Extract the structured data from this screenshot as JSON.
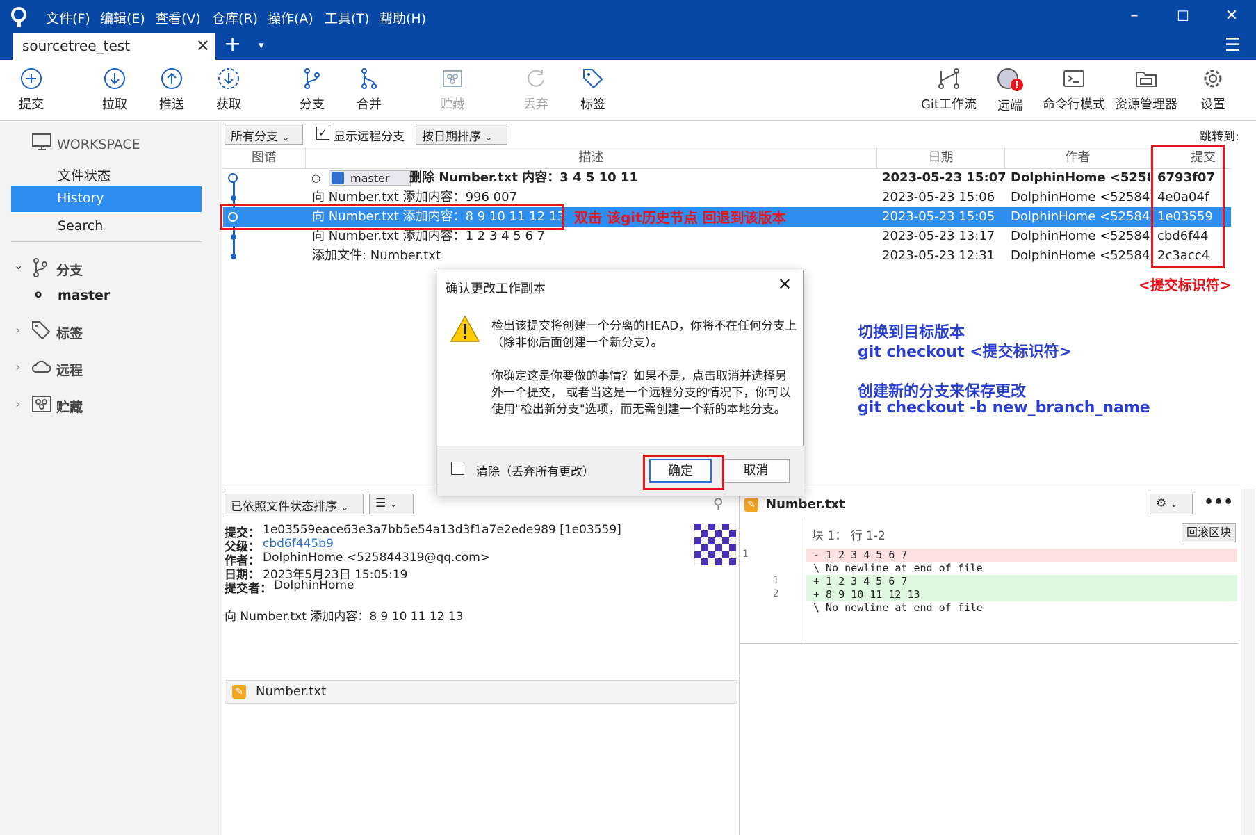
{
  "menu": [
    "文件(F)",
    "编辑(E)",
    "查看(V)",
    "仓库(R)",
    "操作(A)",
    "工具(T)",
    "帮助(H)"
  ],
  "tab": {
    "label": "sourcetree_test",
    "close": "✕",
    "add": "+",
    "more": "▾"
  },
  "toolbar": {
    "commit": "提交",
    "pull": "拉取",
    "push": "推送",
    "fetch": "获取",
    "branch": "分支",
    "merge": "合并",
    "stash": "贮藏",
    "discard": "丢弃",
    "tag": "标签",
    "gitflow": "Git工作流",
    "remote": "远端",
    "terminal": "命令行模式",
    "explorer": "资源管理器",
    "settings": "设置"
  },
  "sidebar": {
    "workspace": "WORKSPACE",
    "file_status": "文件状态",
    "history": "History",
    "search": "Search",
    "branches": "分支",
    "master": "master",
    "tags": "标签",
    "remotes": "远程",
    "stashes": "贮藏"
  },
  "filters": {
    "branches": "所有分支",
    "show_remote": "显示远程分支",
    "sort": "按日期排序",
    "jump": "跳转到:"
  },
  "columns": {
    "graph": "图谱",
    "desc": "描述",
    "date": "日期",
    "author": "作者",
    "commit": "提交"
  },
  "commits": [
    {
      "desc": "删除 Number.txt 内容：3 4 5 10 11",
      "date": "2023-05-23 15:07",
      "author": "DolphinHome <52584",
      "hash": "6793f07",
      "branch": "master"
    },
    {
      "desc": "向 Number.txt 添加内容：996 007",
      "date": "2023-05-23 15:06",
      "author": "DolphinHome <52584",
      "hash": "4e0a04f"
    },
    {
      "desc": "向 Number.txt 添加内容：8 9 10 11 12 13",
      "date": "2023-05-23 15:05",
      "author": "DolphinHome <52584",
      "hash": "1e03559"
    },
    {
      "desc": "向 Number.txt 添加内容：1 2 3 4 5 6 7",
      "date": "2023-05-23 13:17",
      "author": "DolphinHome <52584",
      "hash": "cbd6f44"
    },
    {
      "desc": "添加文件: Number.txt",
      "date": "2023-05-23 12:31",
      "author": "DolphinHome <52584",
      "hash": "2c3acc4"
    }
  ],
  "annotations": {
    "double_click": "双击 该git历史节点 回退到该版本",
    "commit_id": "<提交标识符>",
    "switch_title": "切换到目标版本",
    "switch_cmd": "git checkout <提交标识符>",
    "branch_title": "创建新的分支来保存更改",
    "branch_cmd": "git checkout -b new_branch_name"
  },
  "dialog": {
    "title": "确认更改工作副本",
    "p1": "检出该提交将创建一个分离的HEAD，你将不在任何分支上（除非你后面创建一个新分支）。",
    "p2": "你确定这是你要做的事情？如果不是，点击取消并选择另外一个提交， 或者当这是一个远程分支的情况下，你可以使用\"检出新分支\"选项，而无需创建一个新的本地分支。",
    "clean": "清除（丢弃所有更改）",
    "ok": "确定",
    "cancel": "取消"
  },
  "details": {
    "sort_label": "已依照文件状态排序",
    "commit_label": "提交：",
    "commit_value": "1e03559eace63e3a7bb5e54a13d3f1a7e2ede989 [1e03559]",
    "parent_label": "父级：",
    "parent_value": "cbd6f445b9",
    "author_label": "作者：",
    "author_value": "DolphinHome <525844319@qq.com>",
    "date_label": "日期：",
    "date_value": "2023年5月23日 15:05:19",
    "committer_label": "提交者：",
    "committer_value": "DolphinHome",
    "message": "向 Number.txt 添加内容：8 9 10 11 12 13",
    "file": "Number.txt"
  },
  "diff": {
    "file": "Number.txt",
    "hunk": "块 1： 行 1-2",
    "revert": "回滚区块",
    "lines": [
      {
        "old": "1",
        "new": "",
        "text": "- 1 2 3 4 5 6 7",
        "type": "del"
      },
      {
        "old": "",
        "new": "",
        "text": "\\ No newline at end of file",
        "type": "meta"
      },
      {
        "old": "",
        "new": "1",
        "text": "+ 1 2 3 4 5 6 7",
        "type": "add"
      },
      {
        "old": "",
        "new": "2",
        "text": "+ 8 9 10 11 12 13",
        "type": "add"
      },
      {
        "old": "",
        "new": "",
        "text": "\\ No newline at end of file",
        "type": "meta"
      }
    ]
  },
  "colors": {
    "titlebar": "#0747a6",
    "selected": "#2e8ef0",
    "annotation_red": "#e8141c",
    "annotation_blue": "#2a3fcf"
  }
}
